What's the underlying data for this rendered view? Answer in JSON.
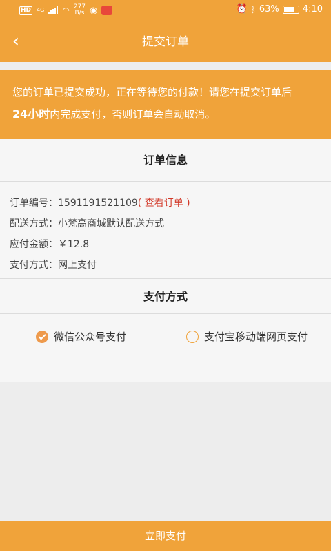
{
  "status": {
    "hd": "HD",
    "network": "4G",
    "speed_value": "277",
    "speed_unit": "B/s",
    "battery": "63%",
    "time": "4:10"
  },
  "header": {
    "title": "提交订单",
    "back_icon": "chevron-left-icon"
  },
  "notice": {
    "line1": "您的订单已提交成功，正在等待您的付款！请您在提交订单后",
    "bold": "24小时",
    "line2": "内完成支付，否则订单会自动取消。"
  },
  "order_info": {
    "title": "订单信息",
    "rows": [
      {
        "label": "订单编号：",
        "value": "1591191521109",
        "link": "( 查看订单 )"
      },
      {
        "label": "配送方式：",
        "value": "小梵高商城默认配送方式"
      },
      {
        "label": "应付金额：",
        "value": "￥12.8"
      },
      {
        "label": "支付方式：",
        "value": "网上支付"
      }
    ]
  },
  "payment": {
    "title": "支付方式",
    "options": [
      {
        "label": "微信公众号支付",
        "selected": true
      },
      {
        "label": "支付宝移动端网页支付",
        "selected": false
      }
    ]
  },
  "footer": {
    "pay_button": "立即支付"
  },
  "colors": {
    "accent": "#f0a33a",
    "link": "#d23a2a",
    "background": "#ededed"
  }
}
